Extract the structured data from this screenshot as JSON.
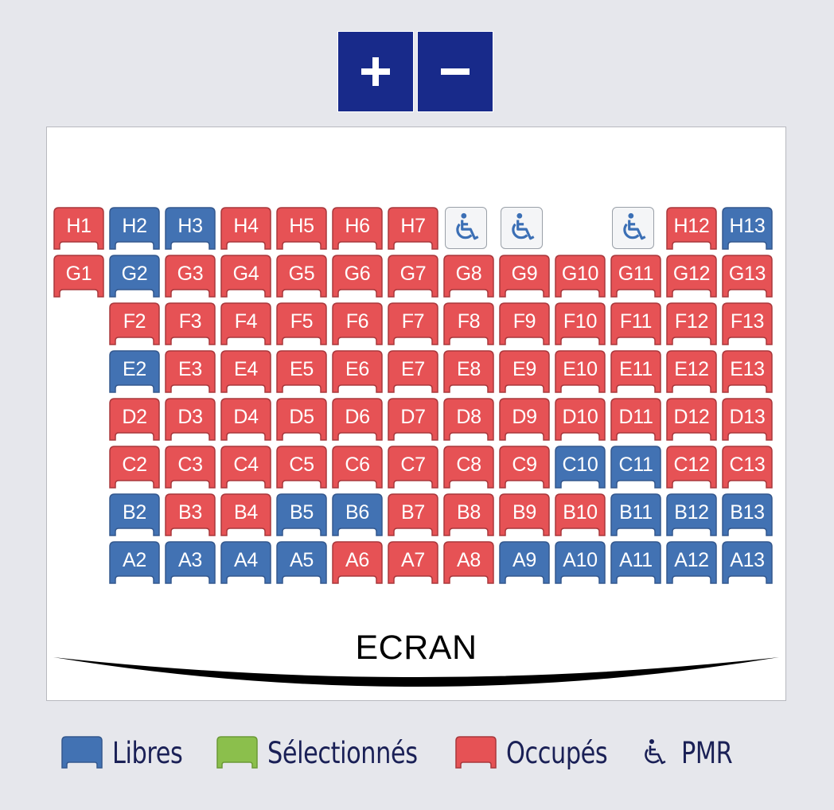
{
  "zoom": {
    "zoom_in_label": "+",
    "zoom_out_label": "−"
  },
  "colors": {
    "libre": "#4272b3",
    "occupe": "#e65255",
    "selectionne": "#8bbf4c",
    "libre_edge": "#34588e",
    "occupe_edge": "#a8383c",
    "selectionne_edge": "#6b9a36"
  },
  "seat_map": {
    "columns": [
      "1",
      "2",
      "3",
      "4",
      "5",
      "6",
      "7",
      "8",
      "9",
      "10",
      "11",
      "12",
      "13"
    ],
    "rows": [
      {
        "row": "H",
        "seats": [
          {
            "col": 1,
            "label": "H1",
            "status": "occupe"
          },
          {
            "col": 2,
            "label": "H2",
            "status": "libre"
          },
          {
            "col": 3,
            "label": "H3",
            "status": "libre"
          },
          {
            "col": 4,
            "label": "H4",
            "status": "occupe"
          },
          {
            "col": 5,
            "label": "H5",
            "status": "occupe"
          },
          {
            "col": 6,
            "label": "H6",
            "status": "occupe"
          },
          {
            "col": 7,
            "label": "H7",
            "status": "occupe"
          },
          {
            "col": 8,
            "label": "",
            "status": "pmr",
            "icon": "wheelchair-icon"
          },
          {
            "col": 9,
            "label": "",
            "status": "pmr",
            "icon": "wheelchair-icon"
          },
          {
            "col": 11,
            "label": "",
            "status": "pmr",
            "icon": "wheelchair-icon"
          },
          {
            "col": 12,
            "label": "H12",
            "status": "occupe"
          },
          {
            "col": 13,
            "label": "H13",
            "status": "libre"
          }
        ]
      },
      {
        "row": "G",
        "seats": [
          {
            "col": 1,
            "label": "G1",
            "status": "occupe"
          },
          {
            "col": 2,
            "label": "G2",
            "status": "libre"
          },
          {
            "col": 3,
            "label": "G3",
            "status": "occupe"
          },
          {
            "col": 4,
            "label": "G4",
            "status": "occupe"
          },
          {
            "col": 5,
            "label": "G5",
            "status": "occupe"
          },
          {
            "col": 6,
            "label": "G6",
            "status": "occupe"
          },
          {
            "col": 7,
            "label": "G7",
            "status": "occupe"
          },
          {
            "col": 8,
            "label": "G8",
            "status": "occupe"
          },
          {
            "col": 9,
            "label": "G9",
            "status": "occupe"
          },
          {
            "col": 10,
            "label": "G10",
            "status": "occupe"
          },
          {
            "col": 11,
            "label": "G11",
            "status": "occupe"
          },
          {
            "col": 12,
            "label": "G12",
            "status": "occupe"
          },
          {
            "col": 13,
            "label": "G13",
            "status": "occupe"
          }
        ]
      },
      {
        "row": "F",
        "seats": [
          {
            "col": 2,
            "label": "F2",
            "status": "occupe"
          },
          {
            "col": 3,
            "label": "F3",
            "status": "occupe"
          },
          {
            "col": 4,
            "label": "F4",
            "status": "occupe"
          },
          {
            "col": 5,
            "label": "F5",
            "status": "occupe"
          },
          {
            "col": 6,
            "label": "F6",
            "status": "occupe"
          },
          {
            "col": 7,
            "label": "F7",
            "status": "occupe"
          },
          {
            "col": 8,
            "label": "F8",
            "status": "occupe"
          },
          {
            "col": 9,
            "label": "F9",
            "status": "occupe"
          },
          {
            "col": 10,
            "label": "F10",
            "status": "occupe"
          },
          {
            "col": 11,
            "label": "F11",
            "status": "occupe"
          },
          {
            "col": 12,
            "label": "F12",
            "status": "occupe"
          },
          {
            "col": 13,
            "label": "F13",
            "status": "occupe"
          }
        ]
      },
      {
        "row": "E",
        "seats": [
          {
            "col": 2,
            "label": "E2",
            "status": "libre"
          },
          {
            "col": 3,
            "label": "E3",
            "status": "occupe"
          },
          {
            "col": 4,
            "label": "E4",
            "status": "occupe"
          },
          {
            "col": 5,
            "label": "E5",
            "status": "occupe"
          },
          {
            "col": 6,
            "label": "E6",
            "status": "occupe"
          },
          {
            "col": 7,
            "label": "E7",
            "status": "occupe"
          },
          {
            "col": 8,
            "label": "E8",
            "status": "occupe"
          },
          {
            "col": 9,
            "label": "E9",
            "status": "occupe"
          },
          {
            "col": 10,
            "label": "E10",
            "status": "occupe"
          },
          {
            "col": 11,
            "label": "E11",
            "status": "occupe"
          },
          {
            "col": 12,
            "label": "E12",
            "status": "occupe"
          },
          {
            "col": 13,
            "label": "E13",
            "status": "occupe"
          }
        ]
      },
      {
        "row": "D",
        "seats": [
          {
            "col": 2,
            "label": "D2",
            "status": "occupe"
          },
          {
            "col": 3,
            "label": "D3",
            "status": "occupe"
          },
          {
            "col": 4,
            "label": "D4",
            "status": "occupe"
          },
          {
            "col": 5,
            "label": "D5",
            "status": "occupe"
          },
          {
            "col": 6,
            "label": "D6",
            "status": "occupe"
          },
          {
            "col": 7,
            "label": "D7",
            "status": "occupe"
          },
          {
            "col": 8,
            "label": "D8",
            "status": "occupe"
          },
          {
            "col": 9,
            "label": "D9",
            "status": "occupe"
          },
          {
            "col": 10,
            "label": "D10",
            "status": "occupe"
          },
          {
            "col": 11,
            "label": "D11",
            "status": "occupe"
          },
          {
            "col": 12,
            "label": "D12",
            "status": "occupe"
          },
          {
            "col": 13,
            "label": "D13",
            "status": "occupe"
          }
        ]
      },
      {
        "row": "C",
        "seats": [
          {
            "col": 2,
            "label": "C2",
            "status": "occupe"
          },
          {
            "col": 3,
            "label": "C3",
            "status": "occupe"
          },
          {
            "col": 4,
            "label": "C4",
            "status": "occupe"
          },
          {
            "col": 5,
            "label": "C5",
            "status": "occupe"
          },
          {
            "col": 6,
            "label": "C6",
            "status": "occupe"
          },
          {
            "col": 7,
            "label": "C7",
            "status": "occupe"
          },
          {
            "col": 8,
            "label": "C8",
            "status": "occupe"
          },
          {
            "col": 9,
            "label": "C9",
            "status": "occupe"
          },
          {
            "col": 10,
            "label": "C10",
            "status": "libre"
          },
          {
            "col": 11,
            "label": "C11",
            "status": "libre"
          },
          {
            "col": 12,
            "label": "C12",
            "status": "occupe"
          },
          {
            "col": 13,
            "label": "C13",
            "status": "occupe"
          }
        ]
      },
      {
        "row": "B",
        "seats": [
          {
            "col": 2,
            "label": "B2",
            "status": "libre"
          },
          {
            "col": 3,
            "label": "B3",
            "status": "occupe"
          },
          {
            "col": 4,
            "label": "B4",
            "status": "occupe"
          },
          {
            "col": 5,
            "label": "B5",
            "status": "libre"
          },
          {
            "col": 6,
            "label": "B6",
            "status": "libre"
          },
          {
            "col": 7,
            "label": "B7",
            "status": "occupe"
          },
          {
            "col": 8,
            "label": "B8",
            "status": "occupe"
          },
          {
            "col": 9,
            "label": "B9",
            "status": "occupe"
          },
          {
            "col": 10,
            "label": "B10",
            "status": "occupe"
          },
          {
            "col": 11,
            "label": "B11",
            "status": "libre"
          },
          {
            "col": 12,
            "label": "B12",
            "status": "libre"
          },
          {
            "col": 13,
            "label": "B13",
            "status": "libre"
          }
        ]
      },
      {
        "row": "A",
        "seats": [
          {
            "col": 2,
            "label": "A2",
            "status": "libre"
          },
          {
            "col": 3,
            "label": "A3",
            "status": "libre"
          },
          {
            "col": 4,
            "label": "A4",
            "status": "libre"
          },
          {
            "col": 5,
            "label": "A5",
            "status": "libre"
          },
          {
            "col": 6,
            "label": "A6",
            "status": "occupe"
          },
          {
            "col": 7,
            "label": "A7",
            "status": "occupe"
          },
          {
            "col": 8,
            "label": "A8",
            "status": "occupe"
          },
          {
            "col": 9,
            "label": "A9",
            "status": "libre"
          },
          {
            "col": 10,
            "label": "A10",
            "status": "libre"
          },
          {
            "col": 11,
            "label": "A11",
            "status": "libre"
          },
          {
            "col": 12,
            "label": "A12",
            "status": "libre"
          },
          {
            "col": 13,
            "label": "A13",
            "status": "libre"
          }
        ]
      }
    ]
  },
  "screen": {
    "label": "ECRAN"
  },
  "legend": {
    "libres": "Libres",
    "selectionnes": "Sélectionnés",
    "occupes": "Occupés",
    "pmr": "PMR",
    "pmr_icon": "wheelchair-icon"
  }
}
